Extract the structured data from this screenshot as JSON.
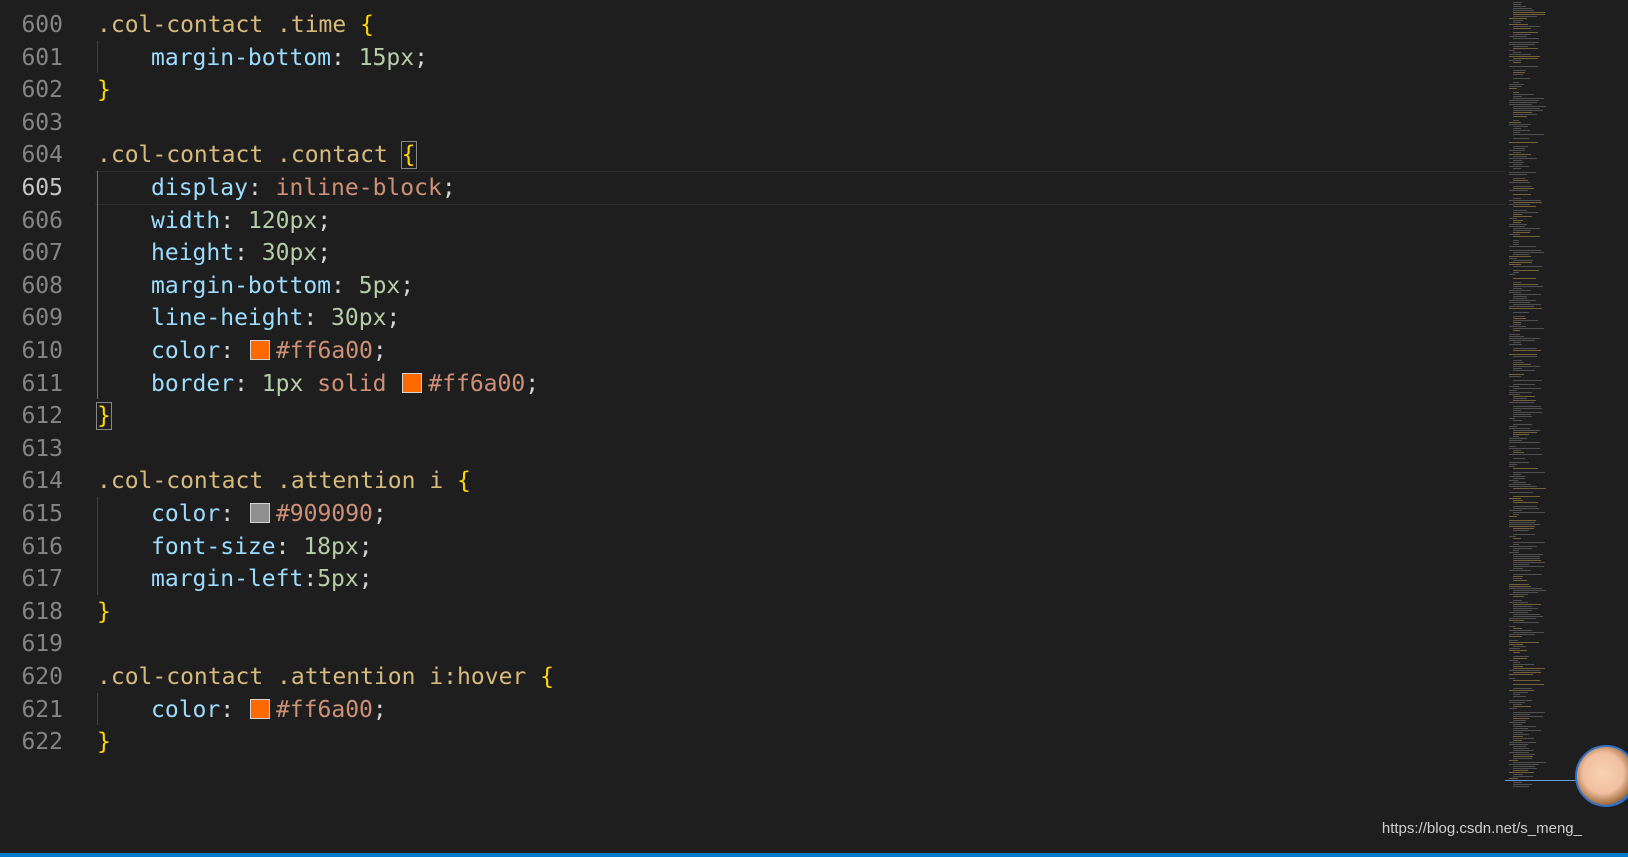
{
  "editor": {
    "active_line": "605",
    "lines": [
      {
        "n": "600",
        "indent": false,
        "tokens": [
          {
            "t": ".col-contact .time ",
            "c": "sel"
          },
          {
            "t": "{",
            "c": "brace"
          }
        ]
      },
      {
        "n": "601",
        "indent": true,
        "tokens": [
          {
            "t": "margin-bottom",
            "c": "prop"
          },
          {
            "t": ": ",
            "c": "punc"
          },
          {
            "t": "15px",
            "c": "num"
          },
          {
            "t": ";",
            "c": "punc"
          }
        ]
      },
      {
        "n": "602",
        "indent": false,
        "tokens": [
          {
            "t": "}",
            "c": "brace"
          }
        ]
      },
      {
        "n": "603",
        "indent": false,
        "tokens": []
      },
      {
        "n": "604",
        "indent": false,
        "tokens": [
          {
            "t": ".col-contact .contact ",
            "c": "sel"
          },
          {
            "t": "{",
            "c": "brace brace-match"
          }
        ]
      },
      {
        "n": "605",
        "indent": true,
        "tokens": [
          {
            "t": "display",
            "c": "prop"
          },
          {
            "t": ": ",
            "c": "punc"
          },
          {
            "t": "inline-block",
            "c": "val"
          },
          {
            "t": ";",
            "c": "punc"
          }
        ]
      },
      {
        "n": "606",
        "indent": true,
        "tokens": [
          {
            "t": "width",
            "c": "prop"
          },
          {
            "t": ": ",
            "c": "punc"
          },
          {
            "t": "120px",
            "c": "num"
          },
          {
            "t": ";",
            "c": "punc"
          }
        ]
      },
      {
        "n": "607",
        "indent": true,
        "tokens": [
          {
            "t": "height",
            "c": "prop"
          },
          {
            "t": ": ",
            "c": "punc"
          },
          {
            "t": "30px",
            "c": "num"
          },
          {
            "t": ";",
            "c": "punc"
          }
        ]
      },
      {
        "n": "608",
        "indent": true,
        "tokens": [
          {
            "t": "margin-bottom",
            "c": "prop"
          },
          {
            "t": ": ",
            "c": "punc"
          },
          {
            "t": "5px",
            "c": "num"
          },
          {
            "t": ";",
            "c": "punc"
          }
        ]
      },
      {
        "n": "609",
        "indent": true,
        "tokens": [
          {
            "t": "line-height",
            "c": "prop"
          },
          {
            "t": ": ",
            "c": "punc"
          },
          {
            "t": "30px",
            "c": "num"
          },
          {
            "t": ";",
            "c": "punc"
          }
        ]
      },
      {
        "n": "610",
        "indent": true,
        "tokens": [
          {
            "t": "color",
            "c": "prop"
          },
          {
            "t": ": ",
            "c": "punc"
          },
          {
            "swatch": "#ff6a00"
          },
          {
            "t": "#ff6a00",
            "c": "val"
          },
          {
            "t": ";",
            "c": "punc"
          }
        ]
      },
      {
        "n": "611",
        "indent": true,
        "tokens": [
          {
            "t": "border",
            "c": "prop"
          },
          {
            "t": ": ",
            "c": "punc"
          },
          {
            "t": "1px",
            "c": "num"
          },
          {
            "t": " solid ",
            "c": "val"
          },
          {
            "swatch": "#ff6a00"
          },
          {
            "t": "#ff6a00",
            "c": "val"
          },
          {
            "t": ";",
            "c": "punc"
          }
        ]
      },
      {
        "n": "612",
        "indent": false,
        "tokens": [
          {
            "t": "}",
            "c": "brace brace-match"
          }
        ]
      },
      {
        "n": "613",
        "indent": false,
        "tokens": []
      },
      {
        "n": "614",
        "indent": false,
        "tokens": [
          {
            "t": ".col-contact .attention i ",
            "c": "sel"
          },
          {
            "t": "{",
            "c": "brace"
          }
        ]
      },
      {
        "n": "615",
        "indent": true,
        "tokens": [
          {
            "t": "color",
            "c": "prop"
          },
          {
            "t": ": ",
            "c": "punc"
          },
          {
            "swatch": "#909090"
          },
          {
            "t": "#909090",
            "c": "val"
          },
          {
            "t": ";",
            "c": "punc"
          }
        ]
      },
      {
        "n": "616",
        "indent": true,
        "tokens": [
          {
            "t": "font-size",
            "c": "prop"
          },
          {
            "t": ": ",
            "c": "punc"
          },
          {
            "t": "18px",
            "c": "num"
          },
          {
            "t": ";",
            "c": "punc"
          }
        ]
      },
      {
        "n": "617",
        "indent": true,
        "tokens": [
          {
            "t": "margin-left",
            "c": "prop"
          },
          {
            "t": ":",
            "c": "punc"
          },
          {
            "t": "5px",
            "c": "num"
          },
          {
            "t": ";",
            "c": "punc"
          }
        ]
      },
      {
        "n": "618",
        "indent": false,
        "tokens": [
          {
            "t": "}",
            "c": "brace"
          }
        ]
      },
      {
        "n": "619",
        "indent": false,
        "tokens": []
      },
      {
        "n": "620",
        "indent": false,
        "tokens": [
          {
            "t": ".col-contact .attention i:hover ",
            "c": "sel"
          },
          {
            "t": "{",
            "c": "brace"
          }
        ]
      },
      {
        "n": "621",
        "indent": true,
        "tokens": [
          {
            "t": "color",
            "c": "prop"
          },
          {
            "t": ": ",
            "c": "punc"
          },
          {
            "swatch": "#ff6a00"
          },
          {
            "t": "#ff6a00",
            "c": "val"
          },
          {
            "t": ";",
            "c": "punc"
          }
        ]
      },
      {
        "n": "622",
        "indent": false,
        "tokens": [
          {
            "t": "}",
            "c": "brace"
          }
        ]
      }
    ]
  },
  "colors": {
    "background": "#1e1e1e",
    "selector": "#d7ba7d",
    "brace": "#ffd700",
    "property": "#9cdcfe",
    "number": "#b5cea8",
    "string_value": "#ce9178",
    "line_number": "#858585",
    "statusbar": "#007acc"
  },
  "watermark": "https://blog.csdn.net/s_meng_"
}
